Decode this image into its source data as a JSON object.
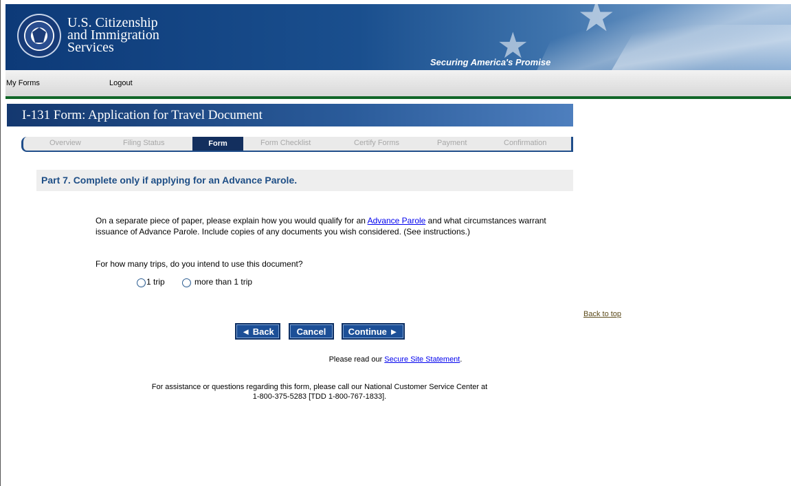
{
  "header": {
    "agency_line1": "U.S. Citizenship",
    "agency_line2": "and Immigration",
    "agency_line3": "Services",
    "tagline": "Securing America's Promise",
    "seal_icon": "dhs-seal-icon",
    "seal_text": "U.S. DEPARTMENT OF HOMELAND SECURITY",
    "colors": {
      "header_blue": "#0d3a78",
      "nav_green": "#116628"
    }
  },
  "nav": {
    "my_forms": "My Forms",
    "logout": "Logout"
  },
  "form": {
    "title": "I-131 Form: Application for Travel Document",
    "tabs": [
      "Overview",
      "Filing Status",
      "Form",
      "Form Checklist",
      "Certify Forms",
      "Payment",
      "Confirmation"
    ],
    "active_tab": "Form"
  },
  "part": {
    "heading": "Part 7. Complete only if applying for an Advance Parole.",
    "explain_before": "On a separate piece of paper, please explain how you would qualify for an ",
    "explain_link": "Advance Parole",
    "explain_after": " and what circumstances warrant issuance of Advance Parole. Include copies of any documents you wish considered. (See instructions.)",
    "question": "For how many trips, do you intend to use this document?",
    "option_one": "1 trip",
    "option_more": "more than 1 trip"
  },
  "back_to_top": "Back to top",
  "buttons": {
    "back": "◄ Back",
    "cancel": "Cancel",
    "continue": "Continue ►"
  },
  "footer": {
    "secure_before": "Please read our ",
    "secure_link": "Secure Site Statement",
    "secure_after": ".",
    "assist_line1": "For assistance or questions regarding this form, please call our National Customer Service Center at",
    "assist_line2": "1-800-375-5283 [TDD 1-800-767-1833]."
  }
}
